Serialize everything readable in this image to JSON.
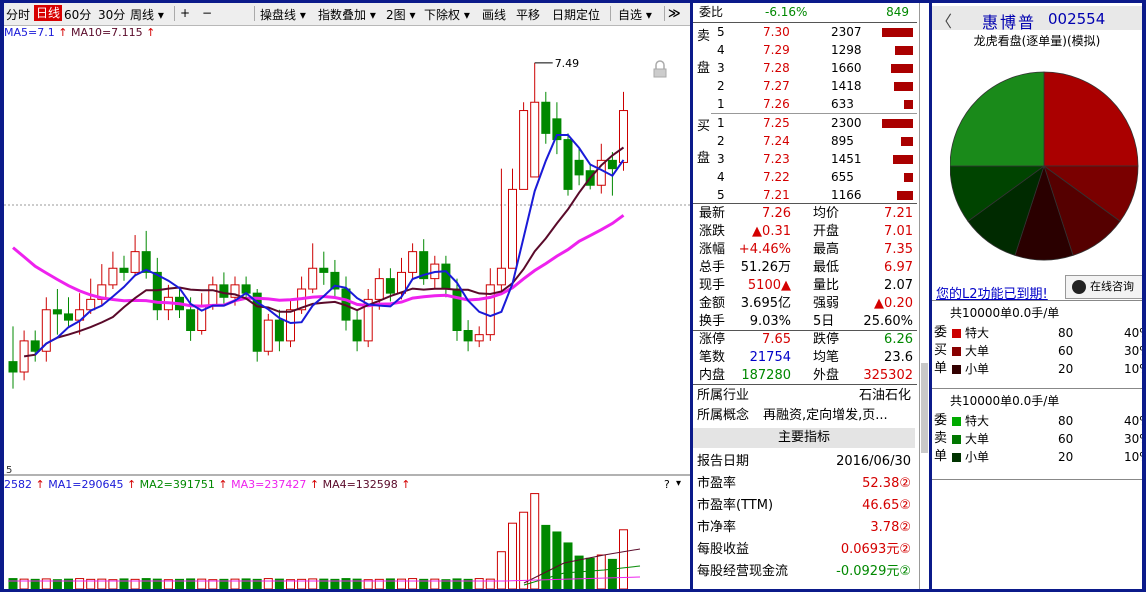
{
  "toolbar": {
    "items": [
      "分时",
      "日线",
      "60分",
      "30分",
      "周线 ▾",
      "+",
      "−",
      "操盘线 ▾",
      "指数叠加 ▾",
      "2图 ▾",
      "下除权 ▾",
      "画线",
      "平移",
      "日期定位",
      "自选 ▾",
      "≫"
    ],
    "selected": "日线"
  },
  "indicator": {
    "ma5": "MA5=7.1",
    "ma10": "MA10=7.115",
    "high_marker": "7.49",
    "vol_prefix": "2582",
    "ma1": "MA1=290645",
    "ma2": "MA2=391751",
    "ma3": "MA3=237427",
    "ma4": "MA4=132598",
    "axis_bottom": "5"
  },
  "colors": {
    "up": "#cc0000",
    "down": "#008800",
    "ma5": "#1a1ad8",
    "ma10": "#5a0a2a",
    "ma20": "#ee22ee",
    "accent": "#d80000",
    "frame": "#0b1a8a"
  },
  "quote": {
    "weibi_label": "委比",
    "weibi_value": "-6.16%",
    "weibi_count": "849",
    "sell_label": "卖盘",
    "buy_label": "买盘",
    "sell": [
      {
        "lvl": "5",
        "price": "7.30",
        "vol": "2307",
        "bar": 0.92
      },
      {
        "lvl": "4",
        "price": "7.29",
        "vol": "1298",
        "bar": 0.52
      },
      {
        "lvl": "3",
        "price": "7.28",
        "vol": "1660",
        "bar": 0.66
      },
      {
        "lvl": "2",
        "price": "7.27",
        "vol": "1418",
        "bar": 0.57
      },
      {
        "lvl": "1",
        "price": "7.26",
        "vol": "633",
        "bar": 0.25
      }
    ],
    "buy": [
      {
        "lvl": "1",
        "price": "7.25",
        "vol": "2300",
        "bar": 0.92
      },
      {
        "lvl": "2",
        "price": "7.24",
        "vol": "895",
        "bar": 0.36
      },
      {
        "lvl": "3",
        "price": "7.23",
        "vol": "1451",
        "bar": 0.58
      },
      {
        "lvl": "4",
        "price": "7.22",
        "vol": "655",
        "bar": 0.26
      },
      {
        "lvl": "5",
        "price": "7.21",
        "vol": "1166",
        "bar": 0.47
      }
    ],
    "stats": [
      {
        "l1": "最新",
        "v1": "7.26",
        "c1": "red",
        "l2": "均价",
        "v2": "7.21",
        "c2": "red"
      },
      {
        "l1": "涨跌",
        "v1": "▲0.31",
        "c1": "red",
        "l2": "开盘",
        "v2": "7.01",
        "c2": "red"
      },
      {
        "l1": "涨幅",
        "v1": "+4.46%",
        "c1": "red",
        "l2": "最高",
        "v2": "7.35",
        "c2": "red"
      },
      {
        "l1": "总手",
        "v1": "51.26万",
        "c1": "black",
        "l2": "最低",
        "v2": "6.97",
        "c2": "red"
      },
      {
        "l1": "现手",
        "v1": "5100▲",
        "c1": "red",
        "l2": "量比",
        "v2": "2.07",
        "c2": "black"
      },
      {
        "l1": "金额",
        "v1": "3.695亿",
        "c1": "black",
        "l2": "强弱",
        "v2": "▲0.20",
        "c2": "red"
      },
      {
        "l1": "换手",
        "v1": "9.03%",
        "c1": "black",
        "l2": "5日",
        "v2": "25.60%",
        "c2": "black"
      }
    ],
    "stats2": [
      {
        "l1": "涨停",
        "v1": "7.65",
        "c1": "red",
        "l2": "跌停",
        "v2": "6.26",
        "c2": "green"
      },
      {
        "l1": "笔数",
        "v1": "21754",
        "c1": "blue",
        "l2": "均笔",
        "v2": "23.6",
        "c2": "black"
      },
      {
        "l1": "内盘",
        "v1": "187280",
        "c1": "green",
        "l2": "外盘",
        "v2": "325302",
        "c2": "red"
      }
    ],
    "industry_label": "所属行业",
    "industry_value": "石油石化",
    "concept_label": "所属概念",
    "concept_value": "再融资,定向增发,页...",
    "indicators_title": "主要指标",
    "indicators": [
      {
        "label": "报告日期",
        "value": "2016/06/30",
        "color": "black"
      },
      {
        "label": "市盈率",
        "value": "52.38②",
        "color": "red"
      },
      {
        "label": "市盈率(TTM)",
        "value": "46.65②",
        "color": "red"
      },
      {
        "label": "市净率",
        "value": "3.78②",
        "color": "red"
      },
      {
        "label": "每股收益",
        "value": "0.0693元②",
        "color": "red"
      },
      {
        "label": "每股经营现金流",
        "value": "-0.0929元②",
        "color": "green"
      }
    ]
  },
  "right": {
    "back": "〈",
    "name": "惠博普",
    "code": "002554",
    "subtitle": "龙虎看盘(逐单量)(模拟)",
    "pie": [
      0.25,
      0.1,
      0.1,
      0.1,
      0.1,
      0.1,
      0.25
    ],
    "expire_text": "您的L2功能已到期!",
    "qq_text": "在线咨询",
    "buy_total": "共10000单0.0手/单",
    "sell_total": "共10000单0.0手/单",
    "buy_side": "委买单",
    "sell_side": "委卖单",
    "buy_rows": [
      {
        "label": "特大",
        "count": "80",
        "pct": "40%",
        "color": "#cc0000"
      },
      {
        "label": "大单",
        "count": "60",
        "pct": "30%",
        "color": "#880000"
      },
      {
        "label": "小单",
        "count": "20",
        "pct": "10%",
        "color": "#330000"
      }
    ],
    "sell_rows": [
      {
        "label": "特大",
        "count": "80",
        "pct": "40%",
        "color": "#00aa00"
      },
      {
        "label": "大单",
        "count": "60",
        "pct": "30%",
        "color": "#007700"
      },
      {
        "label": "小单",
        "count": "20",
        "pct": "10%",
        "color": "#003300"
      }
    ]
  },
  "chart_data": {
    "type": "candlestick",
    "ylim": [
      5.6,
      7.6
    ],
    "annotations": [
      "7.49"
    ],
    "series_close_trend": "rising",
    "candles": [
      [
        6.05,
        6.0,
        6.22,
        5.92
      ],
      [
        6.0,
        6.15,
        6.2,
        5.96
      ],
      [
        6.15,
        6.1,
        6.2,
        6.05
      ],
      [
        6.1,
        6.3,
        6.36,
        6.05
      ],
      [
        6.3,
        6.28,
        6.4,
        6.18
      ],
      [
        6.28,
        6.25,
        6.36,
        6.22
      ],
      [
        6.25,
        6.3,
        6.38,
        6.18
      ],
      [
        6.3,
        6.35,
        6.45,
        6.28
      ],
      [
        6.35,
        6.42,
        6.52,
        6.32
      ],
      [
        6.42,
        6.5,
        6.58,
        6.4
      ],
      [
        6.5,
        6.48,
        6.56,
        6.44
      ],
      [
        6.48,
        6.58,
        6.66,
        6.46
      ],
      [
        6.58,
        6.48,
        6.68,
        6.45
      ],
      [
        6.48,
        6.3,
        6.55,
        6.25
      ],
      [
        6.3,
        6.36,
        6.42,
        6.25
      ],
      [
        6.36,
        6.3,
        6.4,
        6.26
      ],
      [
        6.3,
        6.2,
        6.36,
        6.15
      ],
      [
        6.2,
        6.32,
        6.38,
        6.18
      ],
      [
        6.32,
        6.42,
        6.46,
        6.3
      ],
      [
        6.42,
        6.36,
        6.48,
        6.33
      ],
      [
        6.36,
        6.42,
        6.46,
        6.32
      ],
      [
        6.42,
        6.38,
        6.46,
        6.35
      ],
      [
        6.38,
        6.1,
        6.4,
        6.05
      ],
      [
        6.1,
        6.25,
        6.28,
        6.08
      ],
      [
        6.25,
        6.15,
        6.3,
        6.1
      ],
      [
        6.15,
        6.3,
        6.35,
        6.12
      ],
      [
        6.3,
        6.4,
        6.46,
        6.28
      ],
      [
        6.4,
        6.5,
        6.62,
        6.38
      ],
      [
        6.5,
        6.48,
        6.58,
        6.42
      ],
      [
        6.48,
        6.4,
        6.54,
        6.36
      ],
      [
        6.4,
        6.25,
        6.46,
        6.2
      ],
      [
        6.25,
        6.15,
        6.3,
        6.1
      ],
      [
        6.15,
        6.35,
        6.4,
        6.12
      ],
      [
        6.35,
        6.45,
        6.5,
        6.3
      ],
      [
        6.45,
        6.38,
        6.5,
        6.34
      ],
      [
        6.38,
        6.48,
        6.55,
        6.35
      ],
      [
        6.48,
        6.58,
        6.62,
        6.45
      ],
      [
        6.58,
        6.45,
        6.64,
        6.42
      ],
      [
        6.45,
        6.52,
        6.56,
        6.4
      ],
      [
        6.52,
        6.4,
        6.56,
        6.36
      ],
      [
        6.4,
        6.2,
        6.45,
        6.15
      ],
      [
        6.2,
        6.15,
        6.25,
        6.1
      ],
      [
        6.15,
        6.18,
        6.22,
        6.12
      ],
      [
        6.18,
        6.42,
        6.5,
        6.15
      ],
      [
        6.42,
        6.5,
        6.98,
        6.38
      ],
      [
        6.5,
        6.88,
        6.98,
        6.86
      ],
      [
        6.88,
        7.26,
        7.3,
        6.88
      ],
      [
        6.94,
        7.3,
        7.49,
        6.94
      ],
      [
        7.3,
        7.15,
        7.35,
        7.1
      ],
      [
        7.22,
        7.12,
        7.3,
        7.05
      ],
      [
        7.12,
        6.88,
        7.15,
        6.85
      ],
      [
        7.02,
        6.95,
        7.08,
        6.9
      ],
      [
        6.97,
        6.9,
        7.0,
        6.88
      ],
      [
        6.9,
        7.02,
        7.1,
        6.86
      ],
      [
        7.02,
        6.98,
        7.06,
        6.85
      ],
      [
        7.01,
        7.26,
        7.35,
        6.97
      ]
    ],
    "volume_ylim": [
      0,
      900000
    ]
  }
}
